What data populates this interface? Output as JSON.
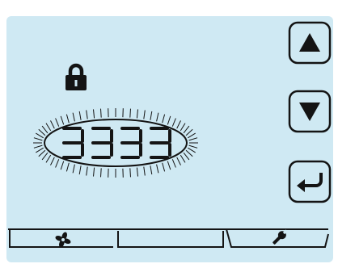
{
  "display": {
    "code_value": "3333",
    "code_state": "flashing",
    "lock_status": "locked",
    "colors": {
      "lcd_background": "#cfe9f3",
      "segment": "#141414",
      "bezel": "#ffffff"
    }
  },
  "buttons": {
    "up": {
      "icon": "triangle-up-icon"
    },
    "down": {
      "icon": "triangle-down-icon"
    },
    "enter": {
      "icon": "enter-return-icon"
    }
  },
  "tabs": [
    {
      "id": "fan",
      "icon": "fan-icon"
    },
    {
      "id": "blank",
      "icon": ""
    },
    {
      "id": "settings",
      "icon": "wrench-icon",
      "active": true
    }
  ]
}
